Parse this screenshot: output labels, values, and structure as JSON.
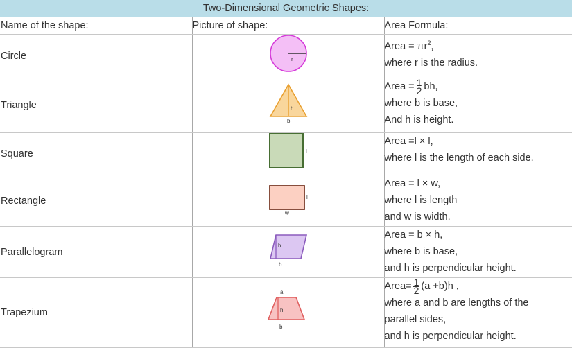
{
  "title": "Two-Dimensional Geometric Shapes:",
  "headers": {
    "name": "Name of the shape:",
    "picture": "Picture of shape:",
    "formula": "Area Formula:"
  },
  "rows": [
    {
      "name": "Circle",
      "labels": {
        "r": "r"
      },
      "formula": {
        "prefix": "Area = πr",
        "sup": "2",
        "suffix": ","
      },
      "lines": [
        "where r is the radius."
      ],
      "color": "#e070e8"
    },
    {
      "name": "Triangle",
      "labels": {
        "h": "h",
        "b": "b"
      },
      "formula": {
        "prefix": "Area =",
        "num": "1",
        "den": "2",
        "suffix": "bh,"
      },
      "lines": [
        "where b is base,",
        "And h is height."
      ],
      "color": "#f5c37a"
    },
    {
      "name": "Square",
      "labels": {
        "l": "l"
      },
      "formula": {
        "prefix": "Area =l × l,"
      },
      "lines": [
        "where l is the length of each side."
      ],
      "color": "#c7d9b6"
    },
    {
      "name": "Rectangle",
      "labels": {
        "l": "l",
        "w": "w"
      },
      "formula": {
        "prefix": "Area = l × w,"
      },
      "lines": [
        "where l is length",
        "and w is width."
      ],
      "color": "#f8c9b9"
    },
    {
      "name": "Parallelogram",
      "labels": {
        "h": "h",
        "b": "b"
      },
      "formula": {
        "prefix": "Area = b × h,"
      },
      "lines": [
        "where b is base,",
        "and h is perpendicular height."
      ],
      "color": "#d9c3ef"
    },
    {
      "name": "Trapezium",
      "labels": {
        "a": "a",
        "h": "h",
        "b": "b"
      },
      "formula": {
        "prefix": "Area=",
        "num": "1",
        "den": "2",
        "suffix": "(a +b)h ,"
      },
      "lines": [
        "where a and b are lengths of the",
        "parallel sides,",
        "and h is perpendicular height."
      ],
      "color": "#f7b9b9"
    }
  ]
}
